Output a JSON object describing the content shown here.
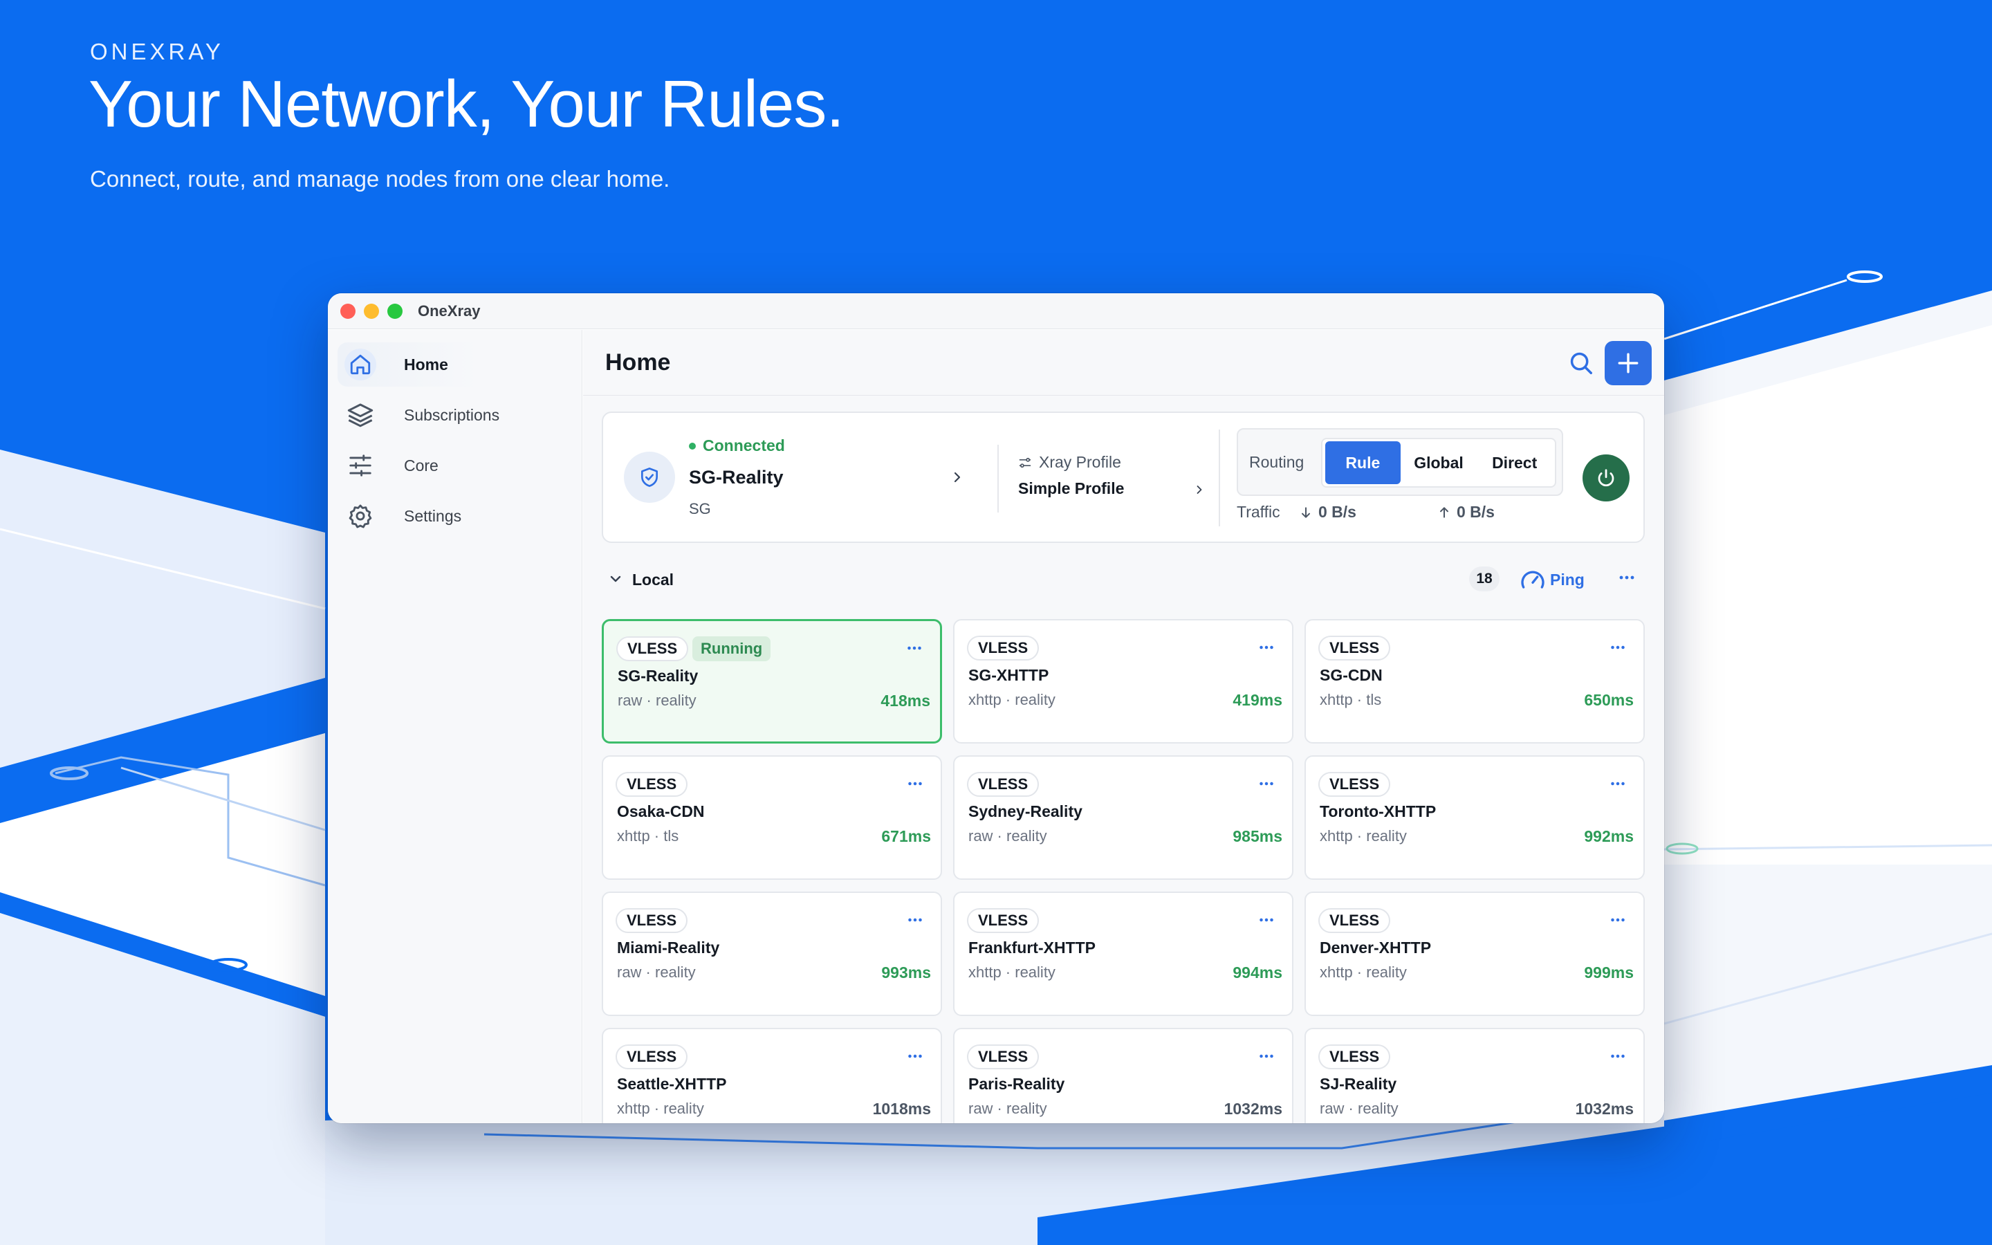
{
  "hero": {
    "brand": "ONEXRAY",
    "title": "Your Network, Your Rules.",
    "subtitle": "Connect, route, and manage nodes from one clear home."
  },
  "window": {
    "title": "OneXray"
  },
  "sidebar": {
    "items": [
      {
        "label": "Home",
        "icon": "home-icon",
        "active": true
      },
      {
        "label": "Subscriptions",
        "icon": "layers-icon",
        "active": false
      },
      {
        "label": "Core",
        "icon": "sliders-icon",
        "active": false
      },
      {
        "label": "Settings",
        "icon": "gear-icon",
        "active": false
      }
    ]
  },
  "main": {
    "title": "Home",
    "connection": {
      "status": "Connected",
      "name": "SG-Reality",
      "region": "SG"
    },
    "profile": {
      "label": "Xray Profile",
      "value": "Simple Profile"
    },
    "routing": {
      "label": "Routing",
      "options": [
        "Rule",
        "Global",
        "Direct"
      ],
      "selected": "Rule"
    },
    "traffic": {
      "label": "Traffic",
      "down": "0 B/s",
      "up": "0 B/s"
    },
    "group": {
      "name": "Local",
      "count": "18",
      "ping_label": "Ping"
    },
    "nodes": [
      {
        "protocol": "VLESS",
        "name": "SG-Reality",
        "meta": "raw · reality",
        "latency": "418ms",
        "running": true,
        "badge": "Running",
        "latency_color": "green"
      },
      {
        "protocol": "VLESS",
        "name": "SG-XHTTP",
        "meta": "xhttp · reality",
        "latency": "419ms",
        "running": false,
        "latency_color": "green"
      },
      {
        "protocol": "VLESS",
        "name": "SG-CDN",
        "meta": "xhttp · tls",
        "latency": "650ms",
        "running": false,
        "latency_color": "green"
      },
      {
        "protocol": "VLESS",
        "name": "Osaka-CDN",
        "meta": "xhttp · tls",
        "latency": "671ms",
        "running": false,
        "latency_color": "green"
      },
      {
        "protocol": "VLESS",
        "name": "Sydney-Reality",
        "meta": "raw · reality",
        "latency": "985ms",
        "running": false,
        "latency_color": "green"
      },
      {
        "protocol": "VLESS",
        "name": "Toronto-XHTTP",
        "meta": "xhttp · reality",
        "latency": "992ms",
        "running": false,
        "latency_color": "green"
      },
      {
        "protocol": "VLESS",
        "name": "Miami-Reality",
        "meta": "raw · reality",
        "latency": "993ms",
        "running": false,
        "latency_color": "green"
      },
      {
        "protocol": "VLESS",
        "name": "Frankfurt-XHTTP",
        "meta": "xhttp · reality",
        "latency": "994ms",
        "running": false,
        "latency_color": "green"
      },
      {
        "protocol": "VLESS",
        "name": "Denver-XHTTP",
        "meta": "xhttp · reality",
        "latency": "999ms",
        "running": false,
        "latency_color": "green"
      },
      {
        "protocol": "VLESS",
        "name": "Seattle-XHTTP",
        "meta": "xhttp · reality",
        "latency": "1018ms",
        "running": false,
        "latency_color": "gray"
      },
      {
        "protocol": "VLESS",
        "name": "Paris-Reality",
        "meta": "raw · reality",
        "latency": "1032ms",
        "running": false,
        "latency_color": "gray"
      },
      {
        "protocol": "VLESS",
        "name": "SJ-Reality",
        "meta": "raw · reality",
        "latency": "1032ms",
        "running": false,
        "latency_color": "gray"
      }
    ]
  },
  "colors": {
    "background_blue": "#0b6cf0",
    "accent": "#2f6fe4",
    "connected_green": "#2d9b57",
    "power_green": "#256e4a",
    "running_border": "#3dbd6b"
  }
}
